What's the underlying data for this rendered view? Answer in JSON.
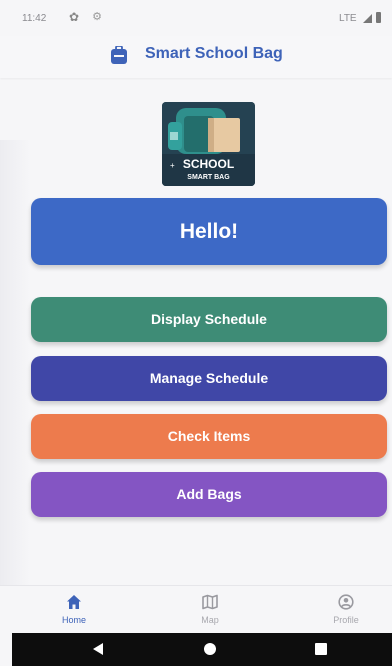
{
  "status_bar": {
    "time": "11:42",
    "network": "LTE"
  },
  "app_bar": {
    "title": "Smart School Bag",
    "icon": "school-bag-icon"
  },
  "logo": {
    "text_line1": "SCHOOL",
    "text_line2": "SMART BAG"
  },
  "greeting": {
    "text": "Hello!"
  },
  "actions": [
    {
      "label": "Display Schedule",
      "color": "#3e8c76"
    },
    {
      "label": "Manage Schedule",
      "color": "#4047a7"
    },
    {
      "label": "Check Items",
      "color": "#ed7b4d"
    },
    {
      "label": "Add Bags",
      "color": "#8455c3"
    }
  ],
  "bottom_nav": {
    "items": [
      {
        "label": "Home",
        "icon": "home-icon",
        "active": true
      },
      {
        "label": "Map",
        "icon": "map-icon",
        "active": false
      },
      {
        "label": "Profile",
        "icon": "profile-icon",
        "active": false
      }
    ]
  },
  "colors": {
    "primary": "#3e63b8",
    "hello_card": "#3d69c6",
    "system_nav": "#0d0d0d"
  }
}
